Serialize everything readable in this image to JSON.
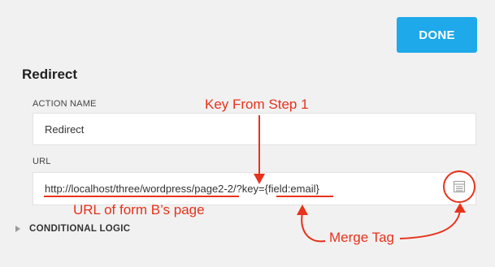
{
  "header": {
    "done_label": "DONE"
  },
  "section": {
    "title": "Redirect"
  },
  "action_name": {
    "label": "ACTION NAME",
    "value": "Redirect"
  },
  "url": {
    "label": "URL",
    "value": "http://localhost/three/wordpress/page2-2/?key={field:email}"
  },
  "conditional_logic": {
    "label": "CONDITIONAL LOGIC"
  },
  "annotations": {
    "key_from_step": "Key From Step 1",
    "url_of_form": "URL of form B’s page",
    "merge_tag": "Merge Tag"
  },
  "colors": {
    "accent": "#1ea9ea",
    "annotation": "#e8321c",
    "background": "#f1f1f1"
  },
  "icons": {
    "merge_tag": "list-icon",
    "expand": "triangle-right-icon"
  }
}
